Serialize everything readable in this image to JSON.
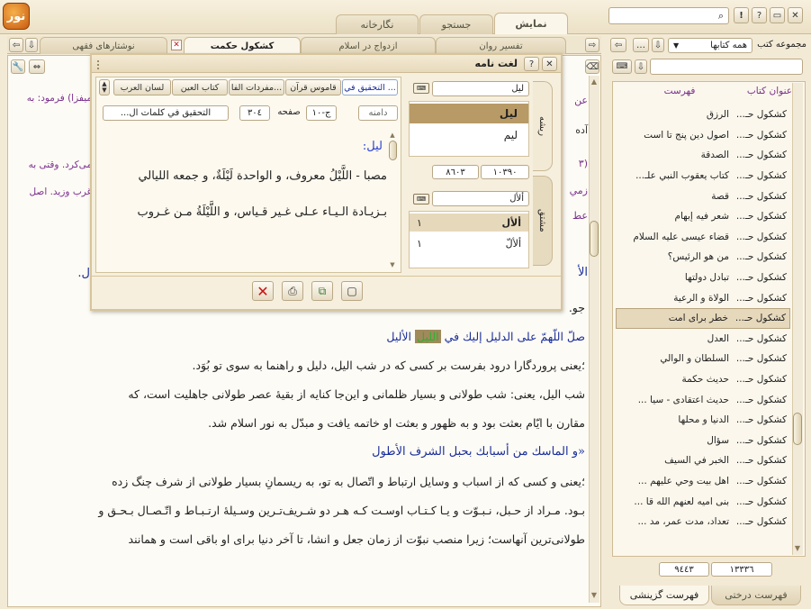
{
  "top_tabs": [
    {
      "label": "نمایش",
      "active": true
    },
    {
      "label": "جستجو",
      "active": false
    },
    {
      "label": "نگارخانه",
      "active": false
    }
  ],
  "window_controls": {
    "close": "✕",
    "restore": "▭",
    "help": "?",
    "info": "!"
  },
  "doc_tabs": [
    {
      "label": "تفسير روان"
    },
    {
      "label": "ازدواج در اسلام"
    },
    {
      "label": "كشكول حكمت",
      "active": true
    },
    {
      "label": "نوشتارهای فقهی"
    }
  ],
  "right_panel": {
    "group_label": "مجموعه کتب",
    "group_value": "همه كتابها",
    "col_title": "عنوان کتاب",
    "col_index": "فهرست",
    "rows": [
      {
        "book": "كشكول حـ...",
        "index": "الرزق"
      },
      {
        "book": "كشكول حـ...",
        "index": "اصول دين پنج تا است"
      },
      {
        "book": "كشكول حـ...",
        "index": "الصدقة"
      },
      {
        "book": "كشكول حـ...",
        "index": "كتاب يعقوب النبي علـ..."
      },
      {
        "book": "كشكول حـ...",
        "index": "قصة"
      },
      {
        "book": "كشكول حـ...",
        "index": "شعر فيه إبهام"
      },
      {
        "book": "كشكول حـ...",
        "index": "قضاء عيسى عليه السلام"
      },
      {
        "book": "كشكول حـ...",
        "index": "من هو الرئيس؟"
      },
      {
        "book": "كشكول حـ...",
        "index": "تبادل دولتها"
      },
      {
        "book": "كشكول حـ...",
        "index": "الولاة و الرعية"
      },
      {
        "book": "كشكول حـ...",
        "index": "خطر براى امت",
        "selected": true
      },
      {
        "book": "كشكول حـ...",
        "index": "العدل"
      },
      {
        "book": "كشكول حـ...",
        "index": "السلطان و الوالي"
      },
      {
        "book": "كشكول حـ...",
        "index": "حديث حكمة"
      },
      {
        "book": "كشكول حـ...",
        "index": "حديث اعتقادى - سيا ..."
      },
      {
        "book": "كشكول حـ...",
        "index": "الدنيا و محلها"
      },
      {
        "book": "كشكول حـ...",
        "index": "سؤال"
      },
      {
        "book": "كشكول حـ...",
        "index": "الخبر في السيف"
      },
      {
        "book": "كشكول حـ...",
        "index": "اهل بيت وحي عليهم ..."
      },
      {
        "book": "كشكول حـ...",
        "index": "بنى اميه لعنهم الله قا ..."
      },
      {
        "book": "كشكول حـ...",
        "index": "تعداد، مدت عمر، مد ..."
      }
    ],
    "count_a": "١٣٣٣٦",
    "count_b": "٩٤٤٣",
    "bottom_tabs": [
      {
        "label": "فهرست درختی"
      },
      {
        "label": "فهرست گزینشی",
        "active": true
      }
    ]
  },
  "dialog": {
    "title": "لغت نامه",
    "source_tabs": [
      "التحقيق في ...",
      "قاموس قرآن",
      "مفردات الفا...",
      "كتاب العين",
      "لسان العرب"
    ],
    "range_label": "دامنه",
    "volume": "ج-١٠",
    "page_label": "صفحه",
    "page": "٣٠٤",
    "book_name": "التحقيق في كلمات ال...",
    "root_label": "ریشه",
    "root_search": "ليل",
    "root_items": [
      {
        "text": "ليل",
        "selected": true
      },
      {
        "text": "ليم"
      }
    ],
    "root_counts": [
      "١٠٣٩٠",
      "٨٦٠٣"
    ],
    "deriv_label": "مشتق",
    "deriv_search": "ألأل",
    "deriv_items": [
      {
        "text": "ألأل",
        "count": "١",
        "selected": true
      },
      {
        "text": "ألألّ",
        "count": "١"
      }
    ],
    "entry_head": "ليل:",
    "entry_line1": "مصبا - اللَّيْلُ معروف، و الواحدة لَيْلَةٌ، و جمعه الليالي",
    "entry_line2": "بـزيـادة الـيـاء عـلى غـير قـياس، و اللَّيْلَةُ مـن غـروب"
  },
  "main_text": {
    "frag1": "عن",
    "frag2": "آده",
    "frag_purple1": "ميفزا) فرمود: به",
    "frag_purple2": "مى‌كرد. وقتى به",
    "frag_purple3": "غرب وزيد. اصل",
    "frag_zam": "زمي",
    "frag_at": "عط",
    "frag_al": "الأ",
    "frag_l": "ل.",
    "frag_ju": "جو.",
    "ar_line1_pre": "صلّ اللّهمّ على الدليل إليك في",
    "ar_line1_hl": "الليل",
    "ar_line1_post": "الأليل",
    "p1": "؛يعنى پروردگارا درود بفرست بر كسى كه در  شب اليل، دليل و راهنما به سوى تو بُوَد.",
    "p2": "شب اليل، يعنى:  شب طولانى و بسيار ظلمانى و اين‌جا كنايه از بقيهٔ عصر طولانى جاهليت است، كه",
    "p3": "مقارن با ايّام بعثت بود و به ظهور و بعثت او خاتمه يافت و مبدّل به نور اسلام  شد.",
    "ar_line2": "«و الماسك من أسبابك بحبل الشرف الأطول",
    "p4": "؛يعنى و كسى كه از اسباب و وسايل ارتباط و اتّصال به تو، به ريسمانِ بسيار طولانى از  شرف چنگ زده",
    "p5": "بـود. مـراد از حـبل، نـبـوّت و يـا كـتـاب اوسـت كـه هـر دو  شـريف‌تـرين وسـيلهٔ ارتـبـاط و اتّـصـال بـحـق و",
    "p6": "طولانى‌ترين آنهاست؛ زيرا منصب نبوّت از زمان جعل و انشا، تا آخر دنيا براى او باقى است و همانند"
  }
}
